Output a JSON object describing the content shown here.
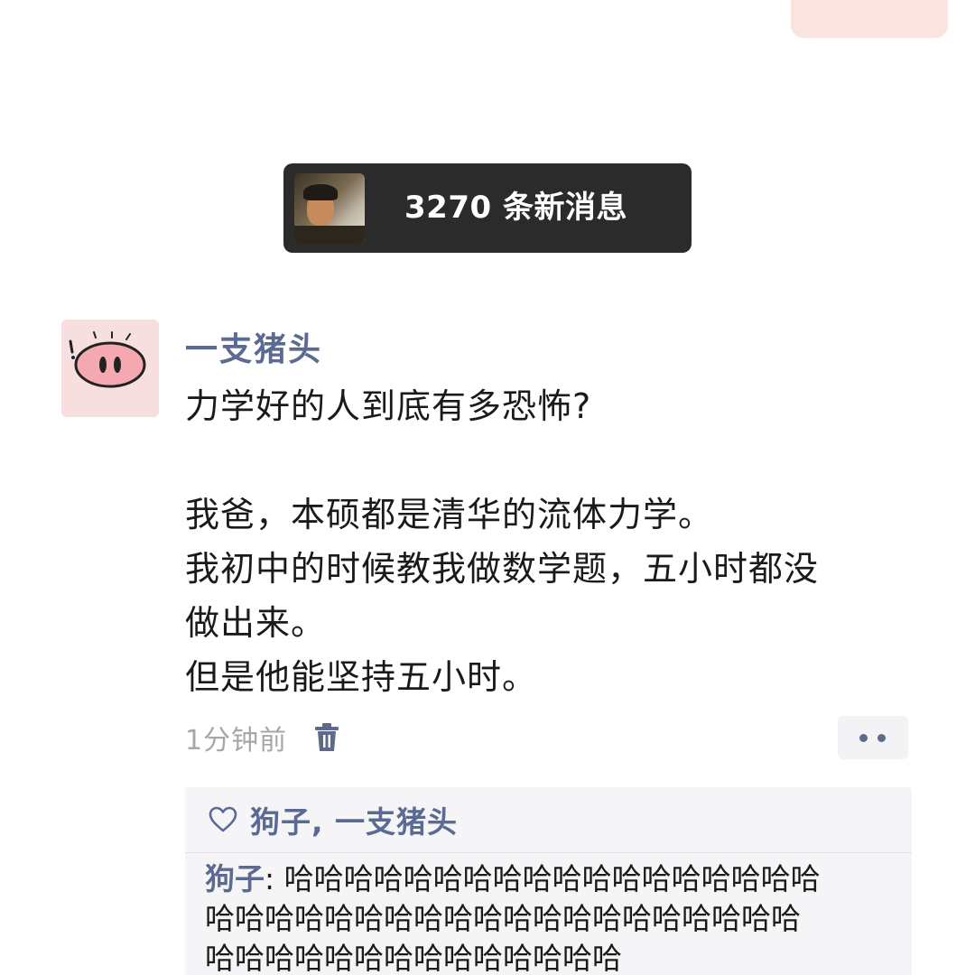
{
  "new_messages": {
    "label": "3270 条新消息"
  },
  "post": {
    "username": "一支猪头",
    "content_lines": [
      "力学好的人到底有多恐怖?",
      "",
      "我爸，本硕都是清华的流体力学。",
      "我初中的时候教我做数学题，五小时都没",
      "做出来。",
      "但是他能坚持五小时。"
    ],
    "timestamp": "1分钟前",
    "icons": {
      "delete": "trash-icon",
      "more": "more-dots-icon",
      "avatar": "pig-face-icon"
    }
  },
  "likes": {
    "icon": "heart-outline-icon",
    "names": "狗子, 一支猪头"
  },
  "comments": [
    {
      "author": "狗子",
      "separator": ": ",
      "lines": [
        "哈哈哈哈哈哈哈哈哈哈哈哈哈哈哈哈哈哈",
        "哈哈哈哈哈哈哈哈哈哈哈哈哈哈哈哈哈哈哈哈",
        "哈哈哈哈哈哈哈哈哈哈哈哈哈哈"
      ]
    }
  ],
  "colors": {
    "link_blue": "#5a6a93",
    "pill_bg": "#2b2b2b",
    "avatar_bg": "#f7dfe0",
    "own_bubble": "#fbe3df"
  }
}
